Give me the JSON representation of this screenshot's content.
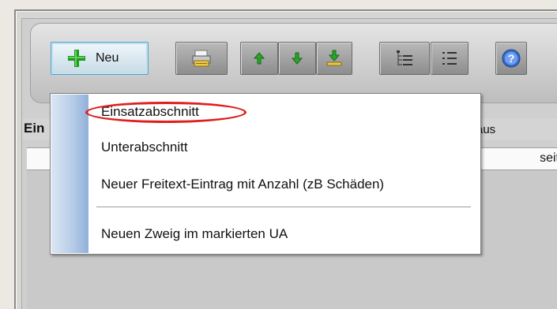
{
  "toolbar": {
    "new_button_label": "Neu",
    "buttons": [
      {
        "icon": "plus-icon",
        "label": "Neu"
      },
      {
        "icon": "print-icon"
      },
      {
        "icon": "arrow-up-icon"
      },
      {
        "icon": "arrow-down-icon"
      },
      {
        "icon": "download-icon"
      },
      {
        "icon": "tree-view-icon"
      },
      {
        "icon": "list-view-icon"
      },
      {
        "icon": "help-icon"
      }
    ]
  },
  "grid": {
    "header_left": "Ein",
    "header_right": "aus",
    "row_right_cell": "seit"
  },
  "menu": {
    "items": [
      {
        "label": "Einsatzabschnitt",
        "highlighted": true
      },
      {
        "label": "Unterabschnitt"
      },
      {
        "label": "Neuer Freitext-Eintrag mit Anzahl (zB Schäden)"
      },
      {
        "separator": true
      },
      {
        "label": "Neuen Zweig im markierten UA"
      }
    ]
  },
  "colors": {
    "plus_green": "#1f9a1f",
    "highlight_ring": "#e01e1e",
    "menu_strip": "#8fb0da",
    "help_blue": "#3a6fd0"
  }
}
